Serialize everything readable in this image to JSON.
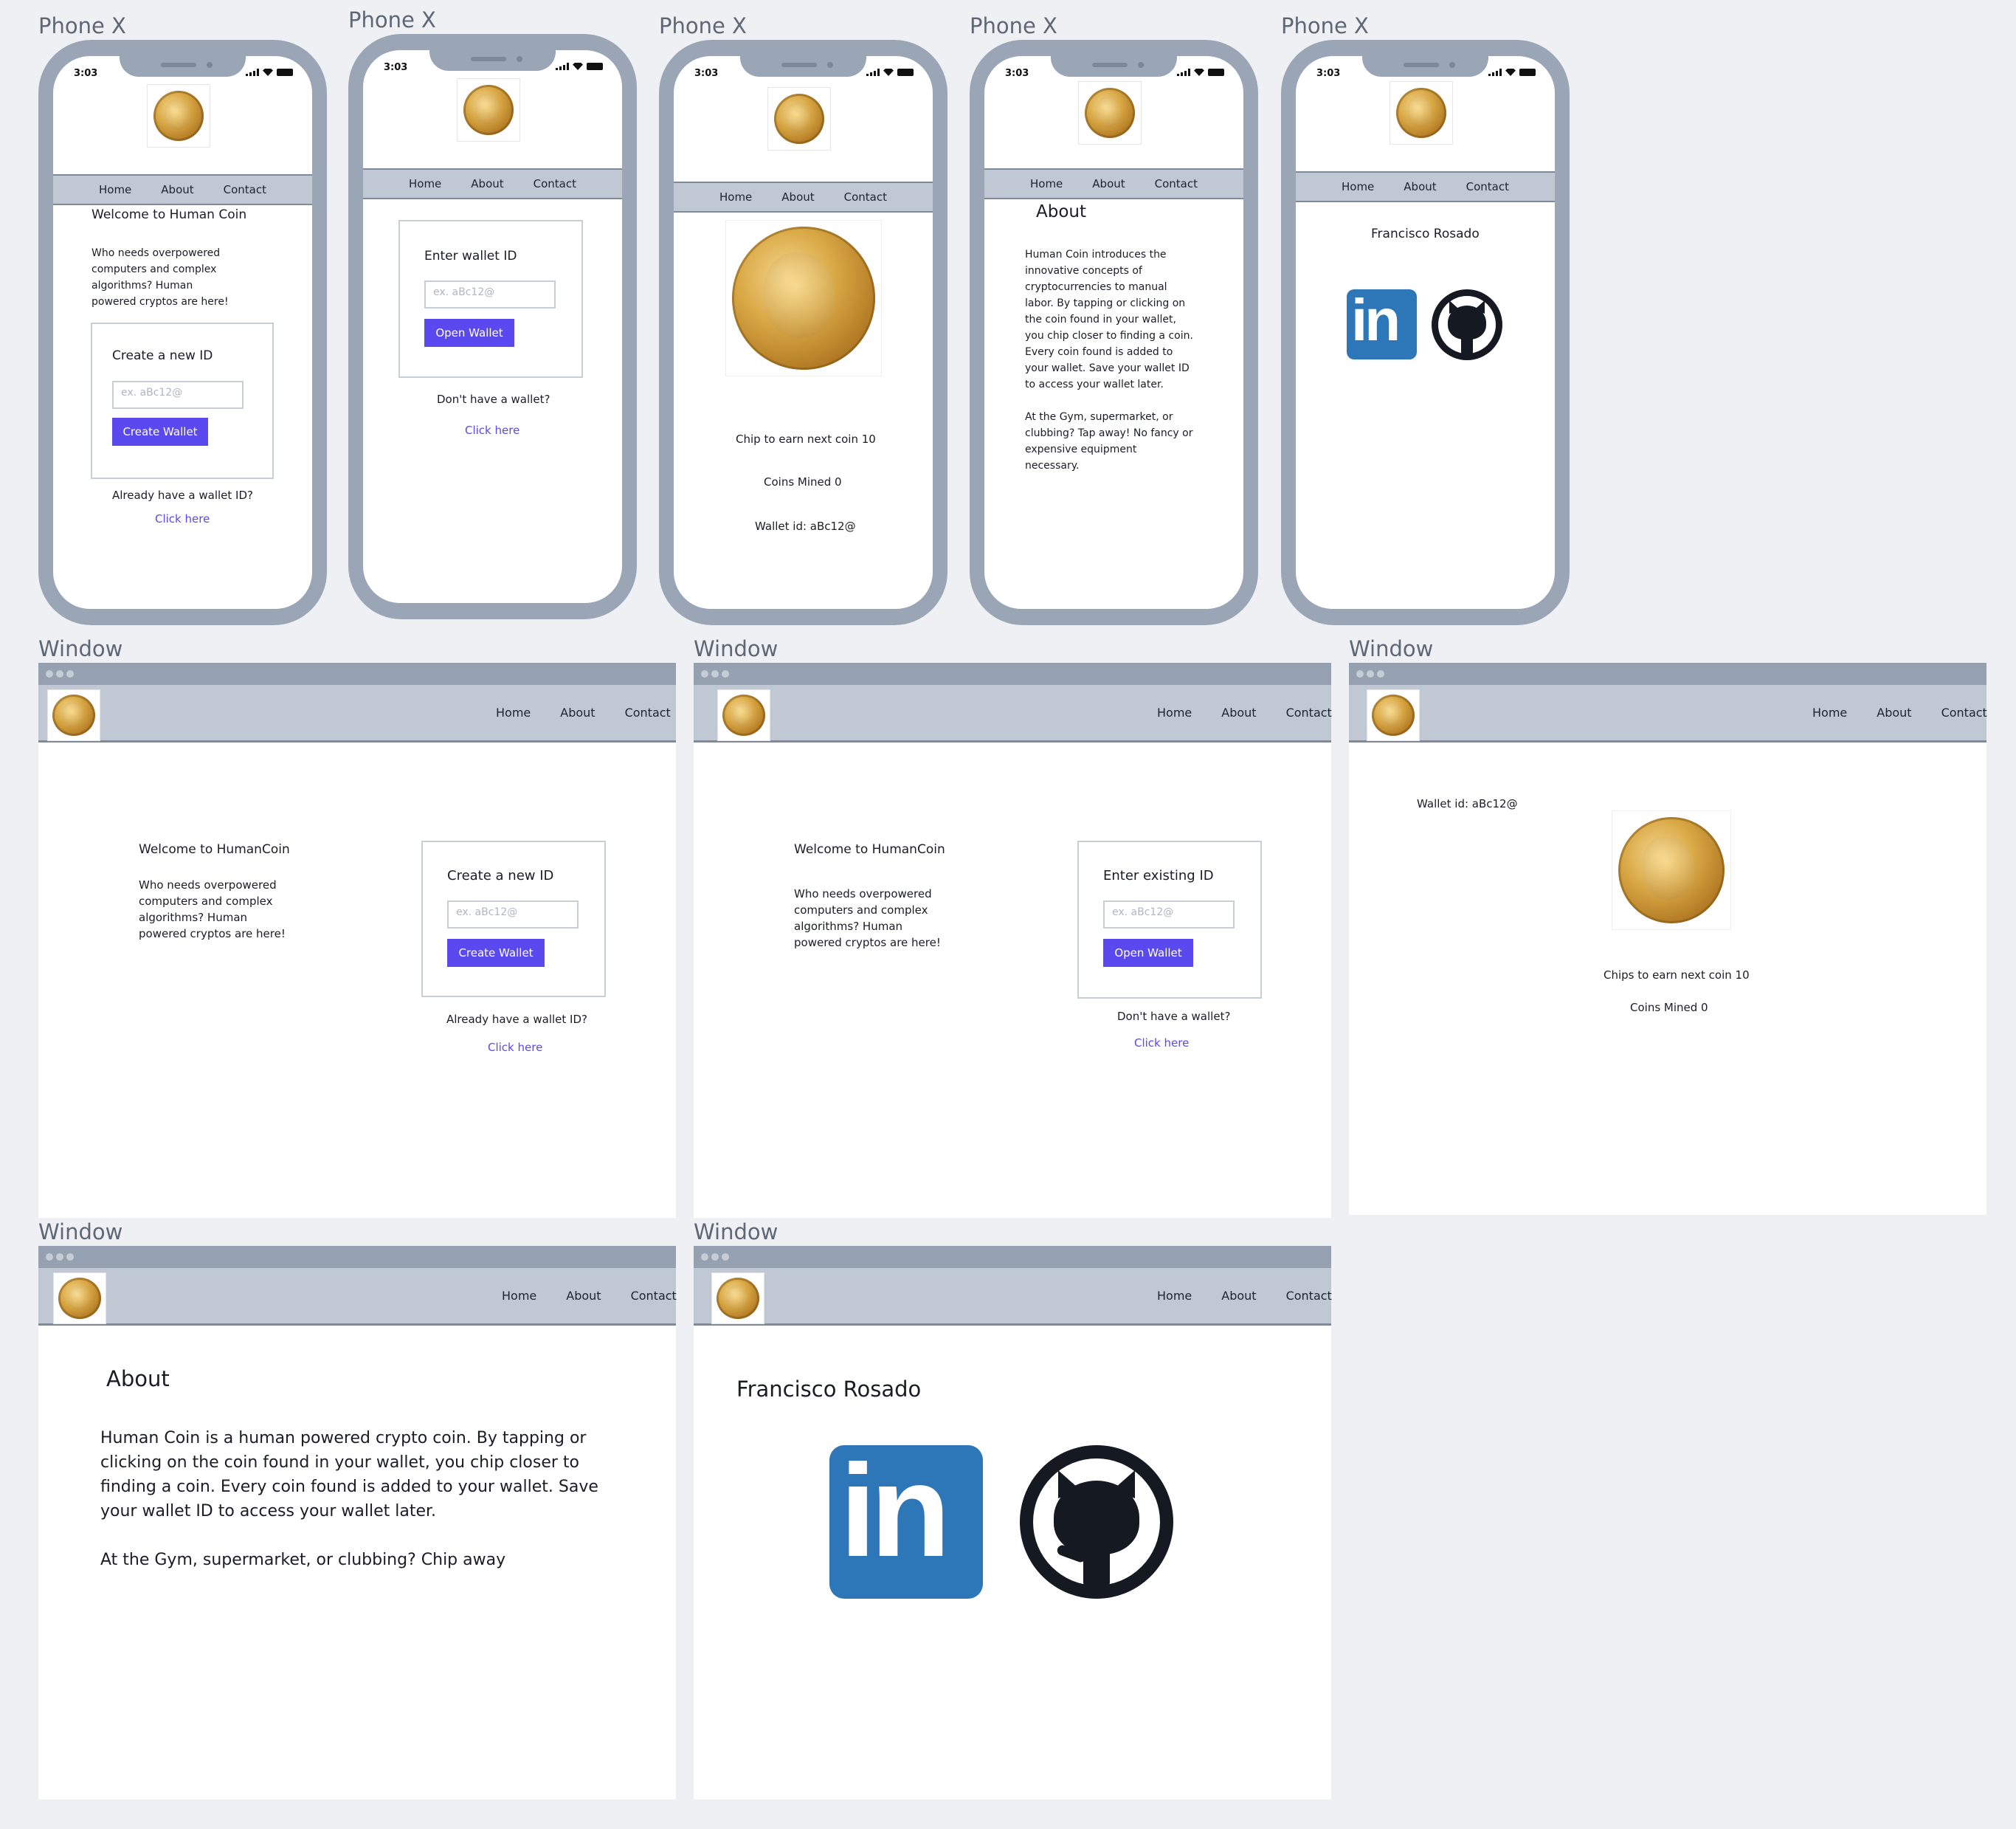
{
  "labels": {
    "phone": "Phone X",
    "window": "Window"
  },
  "status": {
    "time": "3:03"
  },
  "nav": {
    "home": "Home",
    "about": "About",
    "contact": "Contact"
  },
  "intro": {
    "title_phone": "Welcome to Human Coin",
    "title_window": "Welcome to HumanCoin",
    "body": "Who needs overpowered computers and complex algorithms? Human powered cryptos are here!",
    "lines": [
      "Who needs overpowered",
      "computers and complex",
      "algorithms? Human",
      "powered cryptos are here!"
    ]
  },
  "create": {
    "title": "Create a new ID",
    "placeholder": "ex. aBc12@",
    "button": "Create Wallet",
    "prompt": "Already have a wallet ID?",
    "link": "Click here"
  },
  "open_phone": {
    "title": "Enter wallet ID",
    "placeholder": "ex. aBc12@",
    "button": "Open Wallet",
    "prompt": "Don't have a wallet?",
    "link": "Click here"
  },
  "open_window": {
    "title": "Enter existing ID",
    "placeholder": "ex. aBc12@",
    "button": "Open Wallet",
    "prompt": "Don't have a wallet?",
    "link": "Click here"
  },
  "wallet_phone": {
    "chip": "Chip to earn next coin 10",
    "mined": "Coins Mined 0",
    "wallet": "Wallet id: aBc12@"
  },
  "wallet_window": {
    "chip": "Chips to earn next coin 10",
    "mined": "Coins Mined 0",
    "wallet": "Wallet id: aBc12@"
  },
  "about_phone": {
    "title": "About",
    "p1": [
      "Human Coin introduces the",
      "innovative concepts of",
      "cryptocurrencies to manual",
      "labor. By tapping or clicking on",
      "the coin found in your wallet,",
      "you chip closer to finding a coin.",
      "Every coin found is added to",
      "your wallet. Save your wallet ID",
      "to access your wallet later."
    ],
    "p2": [
      "At the Gym, supermarket, or",
      "clubbing? Tap away! No fancy or",
      "expensive equipment",
      "necessary."
    ]
  },
  "about_window": {
    "title": "About",
    "p1": [
      "Human Coin is a human powered crypto coin. By tapping or",
      "clicking on the coin found in your wallet, you chip closer to",
      "finding a coin. Every coin found is added to your wallet. Save",
      "your wallet ID to access your wallet later."
    ],
    "p2": "At the Gym, supermarket, or clubbing? Chip away"
  },
  "contact": {
    "name": "Francisco Rosado",
    "linkedin_text": "in"
  },
  "icons": [
    "coin-logo-icon",
    "linkedin-icon",
    "github-icon",
    "signal-icon",
    "wifi-icon",
    "battery-icon"
  ],
  "colors": {
    "accent": "#5a49ee",
    "nav": "#bfc8d3",
    "frame": "#9aa6b5",
    "linkedin": "#2d77b9",
    "github": "#151a22"
  }
}
